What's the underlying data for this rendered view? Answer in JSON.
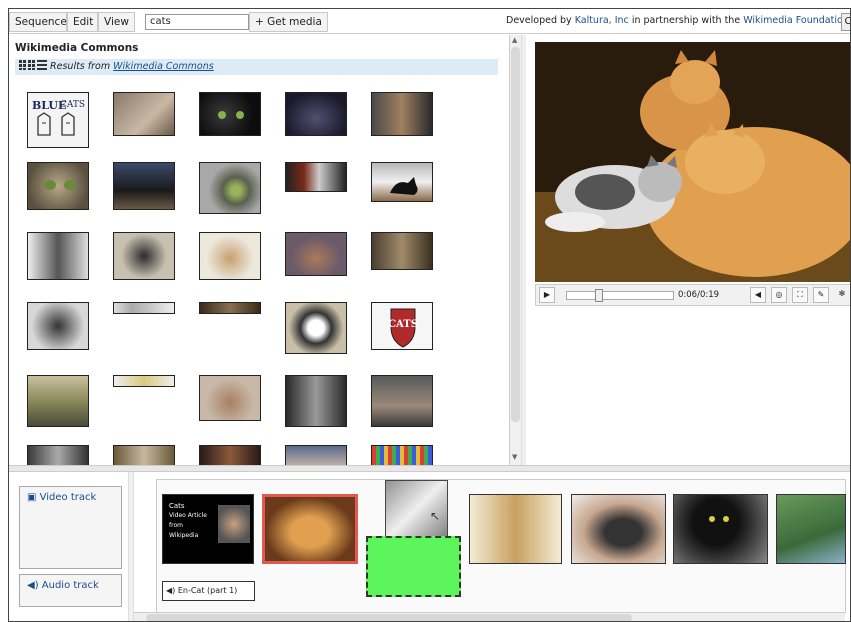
{
  "menu": {
    "sequence_label": "Sequence",
    "edit_label": "Edit",
    "view_label": "View",
    "search_value": "cats",
    "get_media_label": "+ Get media"
  },
  "credit": {
    "prefix": "Developed by",
    "kaltura": "Kaltura, Inc",
    "middle": "in partnership with the",
    "wikimedia": "Wikimedia Foundation",
    "corner_button": "C"
  },
  "library": {
    "title": "Wikimedia Commons",
    "results_prefix": "Results from",
    "results_source": "Wikimedia Commons"
  },
  "player": {
    "time": "0:06/0:19",
    "play_icon": "play-icon",
    "volume_icon": "volume-icon"
  },
  "tracks": {
    "video_label": "Video track",
    "audio_label": "Audio track",
    "audio_clip": "En-Cat (part 1)",
    "title_card": [
      "Cats",
      "Video Article from",
      "Wikipedia"
    ]
  },
  "colors": {
    "selected_clip_border": "#e05a50",
    "drop_target": "#5cf55c",
    "results_bar": "#ddebf7",
    "link": "#1a4d8f"
  }
}
